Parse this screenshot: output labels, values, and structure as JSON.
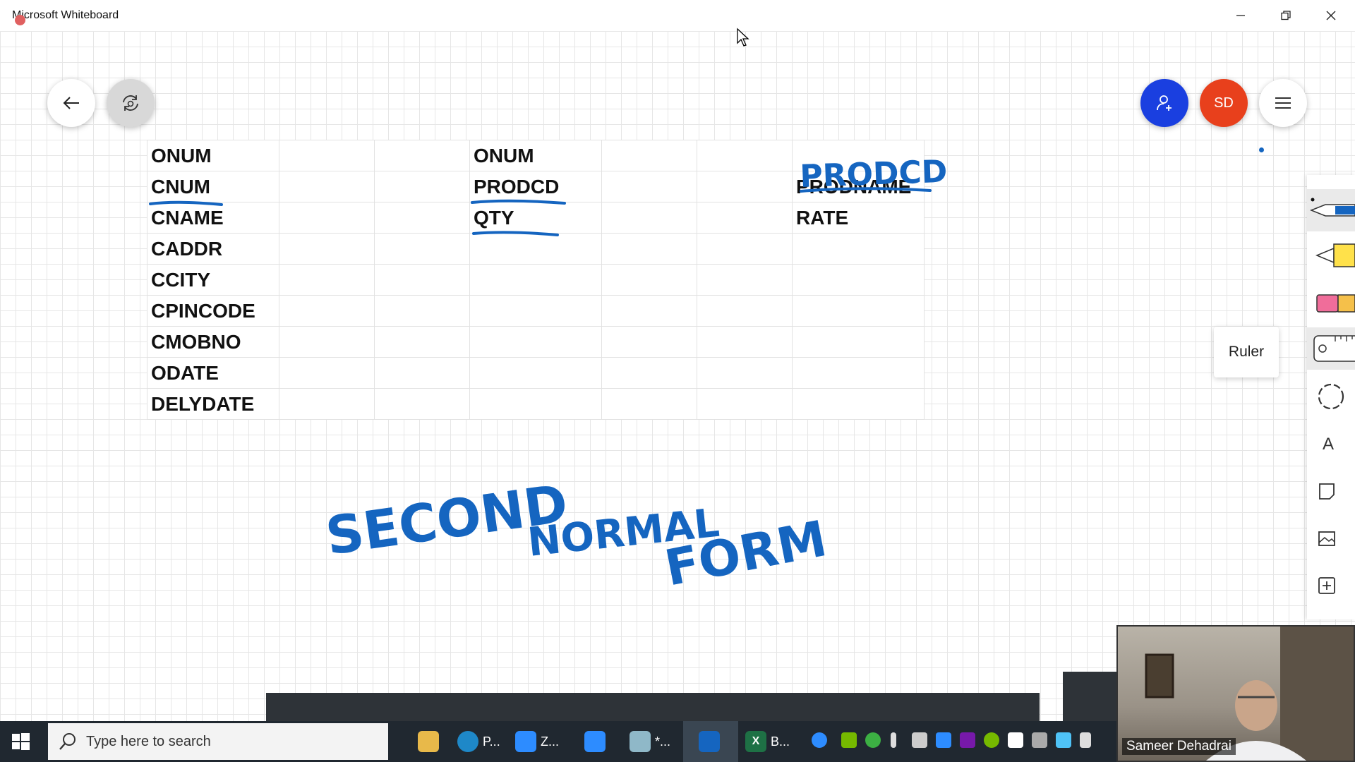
{
  "window": {
    "title": "Microsoft Whiteboard"
  },
  "toolbar_top": {
    "back_icon": "arrow-left-icon",
    "sync_icon": "sync-icon",
    "invite_icon": "add-person-icon",
    "avatar_initials": "SD",
    "menu_icon": "hamburger-icon"
  },
  "table": {
    "rows": [
      [
        "ONUM",
        "",
        "",
        "ONUM",
        "",
        "",
        ""
      ],
      [
        "CNUM",
        "",
        "",
        "PRODCD",
        "",
        "",
        "PRODNAME"
      ],
      [
        "CNAME",
        "",
        "",
        "QTY",
        "",
        "",
        "RATE"
      ],
      [
        "CADDR",
        "",
        "",
        "",
        "",
        "",
        ""
      ],
      [
        "CCITY",
        "",
        "",
        "",
        "",
        "",
        ""
      ],
      [
        "CPINCODE",
        "",
        "",
        "",
        "",
        "",
        ""
      ],
      [
        "CMOBNO",
        "",
        "",
        "",
        "",
        "",
        ""
      ],
      [
        "ODATE",
        "",
        "",
        "",
        "",
        "",
        ""
      ],
      [
        "DELYDATE",
        "",
        "",
        "",
        "",
        "",
        ""
      ]
    ]
  },
  "ink": {
    "prodcd_heading": "PRODCD",
    "line1": "SECOND",
    "line2": "NORMAL",
    "line3": "FORM",
    "color": "#1565c0"
  },
  "right_tools": {
    "tooltip": "Ruler",
    "items": [
      "pen-icon",
      "highlighter-icon",
      "eraser-icon",
      "ruler-icon",
      "lasso-icon",
      "text-icon",
      "note-icon",
      "image-icon",
      "add-icon"
    ],
    "text_tool_label": "A"
  },
  "video": {
    "name": "Sameer Dehadrai"
  },
  "taskbar": {
    "search_placeholder": "Type here to search",
    "apps": [
      {
        "name": "file-explorer-icon",
        "label": ""
      },
      {
        "name": "edge-icon",
        "label": "P..."
      },
      {
        "name": "zoom-icon",
        "label": "Z..."
      },
      {
        "name": "zoom-meeting-icon",
        "label": ""
      },
      {
        "name": "notepad-icon",
        "label": "*..."
      },
      {
        "name": "whiteboard-icon",
        "label": ""
      },
      {
        "name": "excel-icon",
        "label": "B..."
      }
    ]
  },
  "colors": {
    "invite_button": "#1a3fe0",
    "avatar": "#e8401c",
    "ink_blue": "#1565c0",
    "taskbar": "#202830"
  }
}
